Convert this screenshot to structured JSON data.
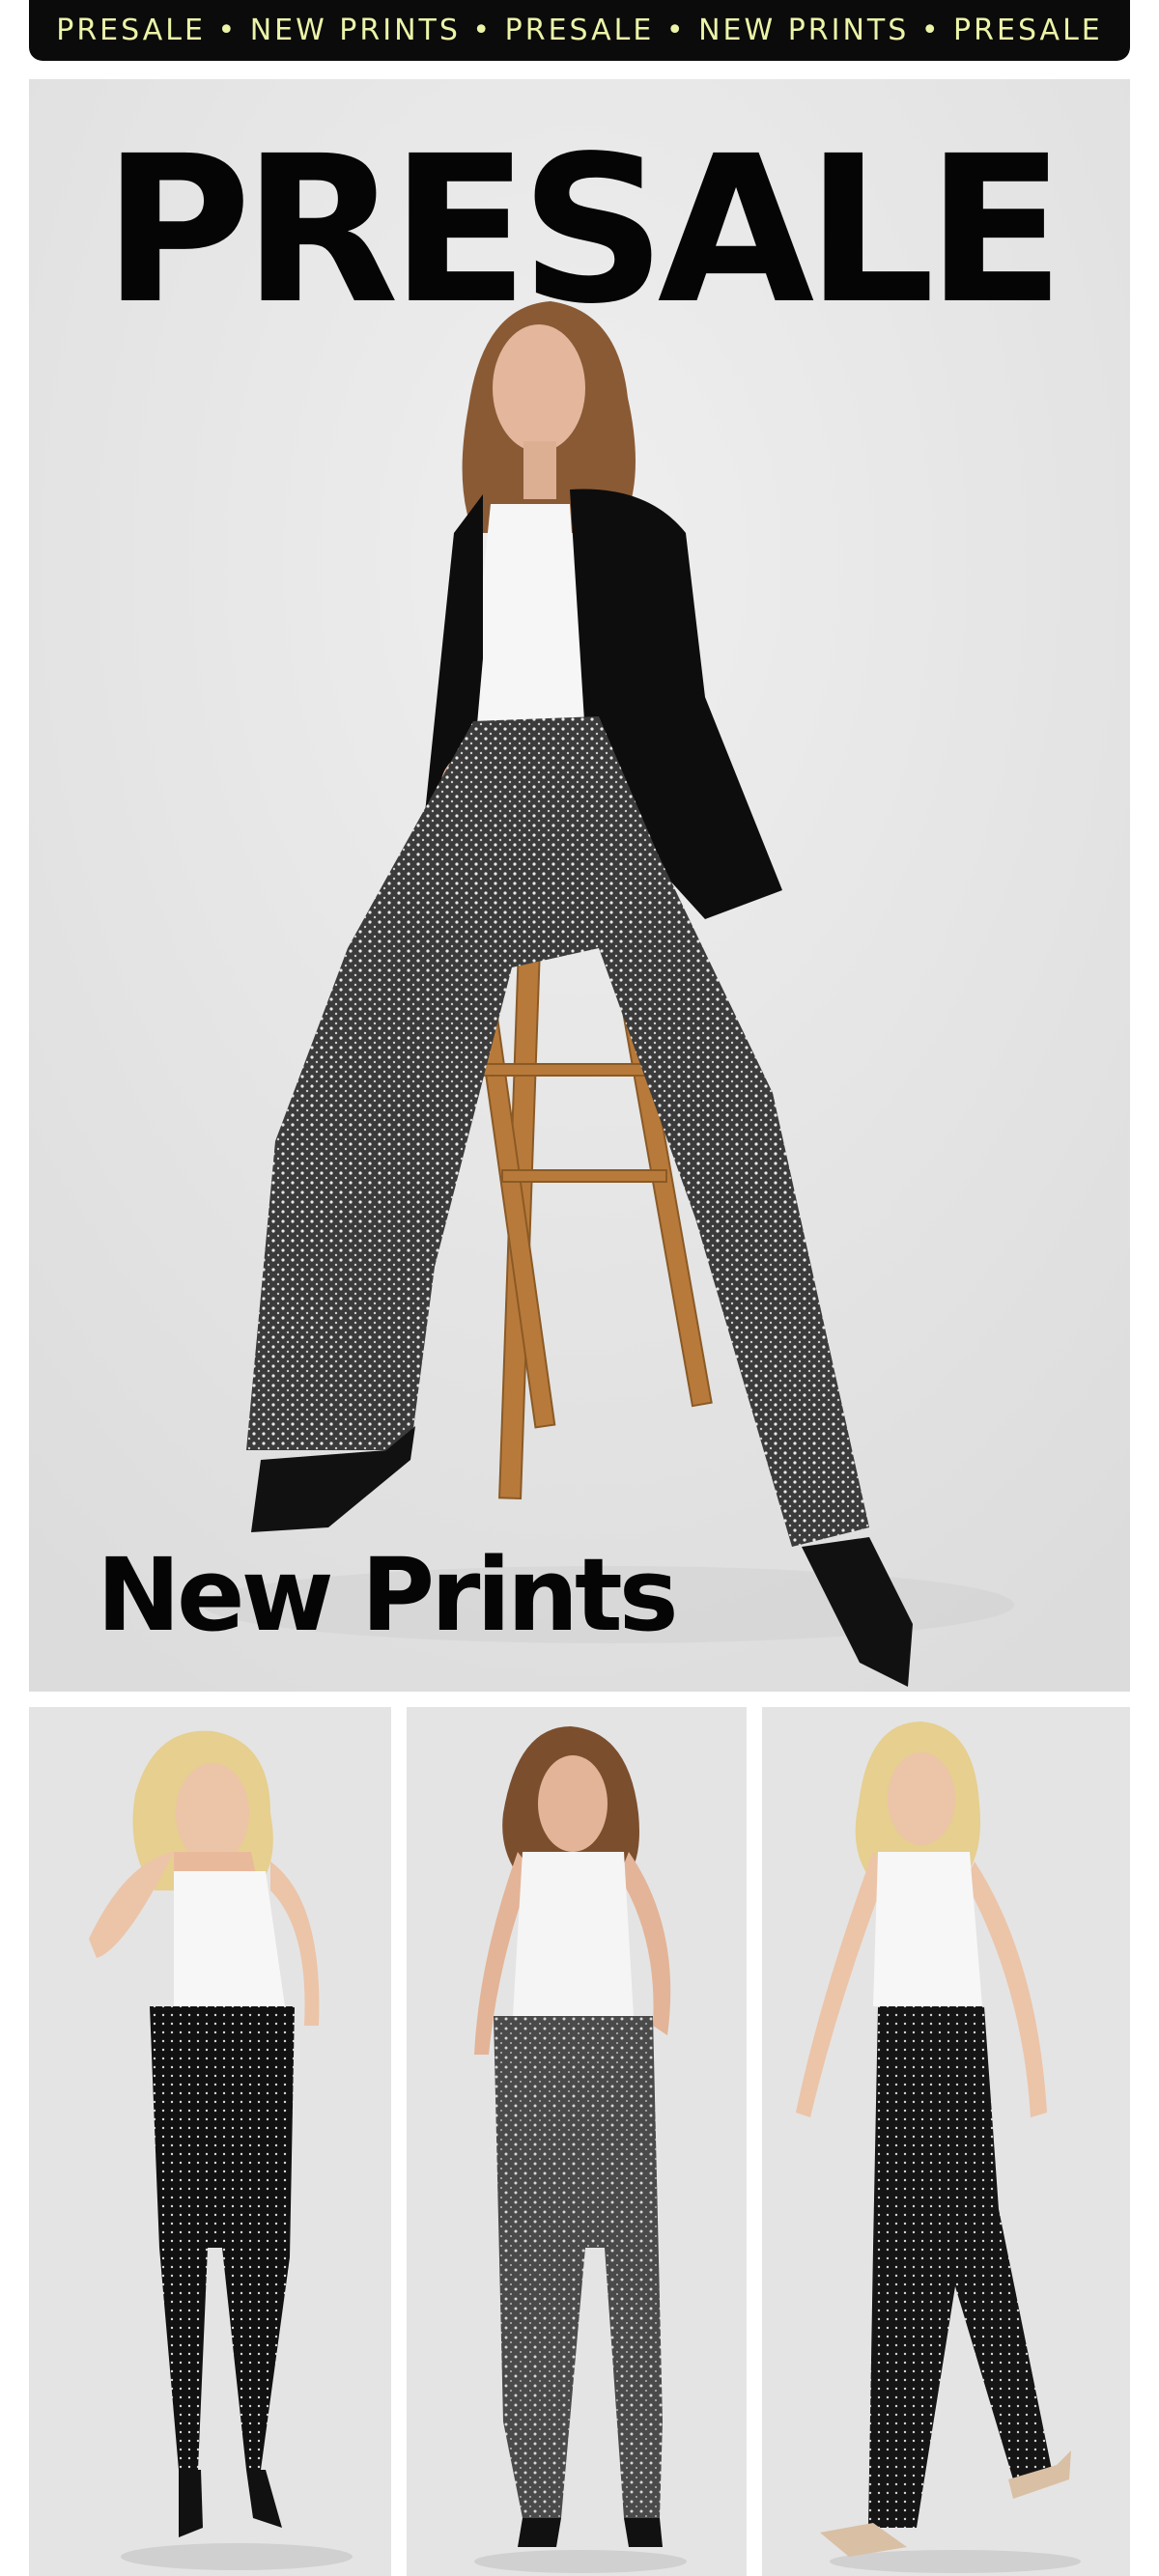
{
  "banner": {
    "text": "PRESALE • NEW PRINTS • PRESALE • NEW PRINTS • PRESALE"
  },
  "hero": {
    "title": "PRESALE",
    "subtitle": "New Prints",
    "image_icon": "model-seated-on-stool-photo"
  },
  "products": [
    {
      "image_icon": "skinny-dot-pants-model-photo"
    },
    {
      "image_icon": "bootcut-dot-pants-model-photo"
    },
    {
      "image_icon": "straight-dot-pants-model-photo"
    }
  ],
  "colors": {
    "banner_bg": "#0b0b0b",
    "banner_text": "#ecf4a8",
    "title": "#050505",
    "photo_bg": "#e6e6e6"
  }
}
